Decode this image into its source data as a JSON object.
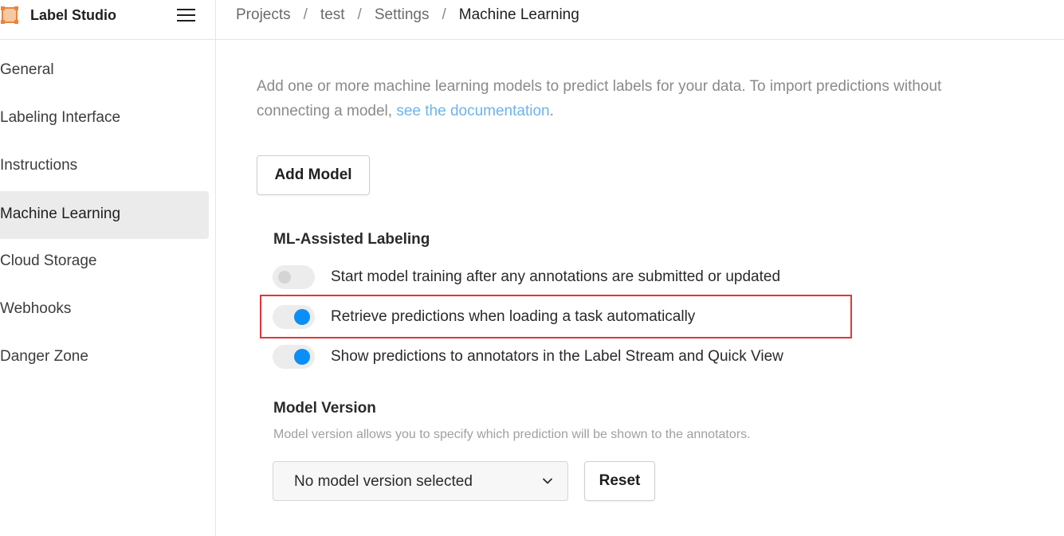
{
  "app": {
    "name": "Label Studio",
    "accent": "#e8843c"
  },
  "breadcrumb": [
    "Projects",
    "test",
    "Settings",
    "Machine Learning"
  ],
  "breadcrumb_separator": "/",
  "sidebar": {
    "items": [
      {
        "label": "General",
        "active": false
      },
      {
        "label": "Labeling Interface",
        "active": false
      },
      {
        "label": "Instructions",
        "active": false
      },
      {
        "label": "Machine Learning",
        "active": true
      },
      {
        "label": "Cloud Storage",
        "active": false
      },
      {
        "label": "Webhooks",
        "active": false
      },
      {
        "label": "Danger Zone",
        "active": false
      }
    ]
  },
  "main": {
    "intro_text": "Add one or more machine learning models to predict labels for your data. To import predictions without connecting a model, ",
    "intro_link": "see the documentation",
    "intro_end": ".",
    "add_model_label": "Add Model",
    "ml_assisted": {
      "title": "ML-Assisted Labeling",
      "toggles": [
        {
          "label": "Start model training after any annotations are submitted or updated",
          "on": false
        },
        {
          "label": "Retrieve predictions when loading a task automatically",
          "on": true,
          "highlighted": true
        },
        {
          "label": "Show predictions to annotators in the Label Stream and Quick View",
          "on": true
        }
      ]
    },
    "model_version": {
      "title": "Model Version",
      "description": "Model version allows you to specify which prediction will be shown to the annotators.",
      "selected": "No model version selected",
      "reset_label": "Reset"
    }
  },
  "colors": {
    "toggle_on": "#0a8ff7",
    "highlight_border": "#e0373a",
    "link": "#6cb4ee"
  }
}
